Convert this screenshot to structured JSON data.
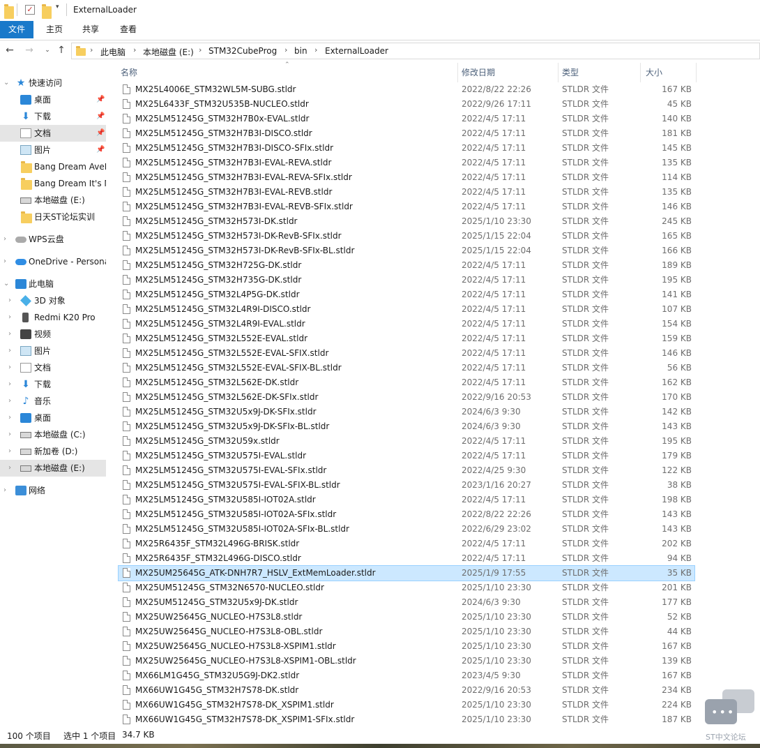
{
  "window": {
    "title": "ExternalLoader"
  },
  "ribbon": {
    "tabs": [
      "文件",
      "主页",
      "共享",
      "查看"
    ]
  },
  "address": {
    "crumbs": [
      "此电脑",
      "本地磁盘 (E:)",
      "STM32CubeProg",
      "bin",
      "ExternalLoader"
    ]
  },
  "sidebar": {
    "items": [
      {
        "label": "快速访问",
        "icon": "star-icon"
      },
      {
        "label": "桌面",
        "icon": "desktop-icon",
        "pinned": true
      },
      {
        "label": "下载",
        "icon": "download-icon",
        "pinned": true
      },
      {
        "label": "文档",
        "icon": "document-icon",
        "pinned": true
      },
      {
        "label": "图片",
        "icon": "picture-icon",
        "pinned": true
      },
      {
        "label": "Bang Dream AveM",
        "icon": "folder-icon"
      },
      {
        "label": "Bang Dream It's M",
        "icon": "folder-icon"
      },
      {
        "label": "本地磁盘 (E:)",
        "icon": "drive-icon"
      },
      {
        "label": "日天ST论坛实训",
        "icon": "folder-icon"
      },
      {
        "label": "WPS云盘",
        "icon": "cloud-icon"
      },
      {
        "label": "OneDrive - Persona",
        "icon": "onedrive-icon"
      },
      {
        "label": "此电脑",
        "icon": "computer-icon"
      },
      {
        "label": "3D 对象",
        "icon": "cube-icon"
      },
      {
        "label": "Redmi K20 Pro",
        "icon": "phone-icon"
      },
      {
        "label": "视频",
        "icon": "video-icon"
      },
      {
        "label": "图片",
        "icon": "picture-icon"
      },
      {
        "label": "文档",
        "icon": "document-icon"
      },
      {
        "label": "下载",
        "icon": "download-icon"
      },
      {
        "label": "音乐",
        "icon": "music-icon"
      },
      {
        "label": "桌面",
        "icon": "desktop-icon"
      },
      {
        "label": "本地磁盘 (C:)",
        "icon": "drive-icon"
      },
      {
        "label": "新加卷 (D:)",
        "icon": "drive-icon"
      },
      {
        "label": "本地磁盘 (E:)",
        "icon": "drive-icon"
      },
      {
        "label": "网络",
        "icon": "network-icon"
      }
    ]
  },
  "columns": {
    "name": "名称",
    "date": "修改日期",
    "type": "类型",
    "size": "大小"
  },
  "files": [
    {
      "name": "MX25L4006E_STM32WL5M-SUBG.stldr",
      "date": "2022/8/22 22:26",
      "type": "STLDR 文件",
      "size": "167 KB"
    },
    {
      "name": "MX25L6433F_STM32U535B-NUCLEO.stldr",
      "date": "2022/9/26 17:11",
      "type": "STLDR 文件",
      "size": "45 KB"
    },
    {
      "name": "MX25LM51245G_STM32H7B0x-EVAL.stldr",
      "date": "2022/4/5 17:11",
      "type": "STLDR 文件",
      "size": "140 KB"
    },
    {
      "name": "MX25LM51245G_STM32H7B3I-DISCO.stldr",
      "date": "2022/4/5 17:11",
      "type": "STLDR 文件",
      "size": "181 KB"
    },
    {
      "name": "MX25LM51245G_STM32H7B3I-DISCO-SFIx.stldr",
      "date": "2022/4/5 17:11",
      "type": "STLDR 文件",
      "size": "145 KB"
    },
    {
      "name": "MX25LM51245G_STM32H7B3I-EVAL-REVA.stldr",
      "date": "2022/4/5 17:11",
      "type": "STLDR 文件",
      "size": "135 KB"
    },
    {
      "name": "MX25LM51245G_STM32H7B3I-EVAL-REVA-SFIx.stldr",
      "date": "2022/4/5 17:11",
      "type": "STLDR 文件",
      "size": "114 KB"
    },
    {
      "name": "MX25LM51245G_STM32H7B3I-EVAL-REVB.stldr",
      "date": "2022/4/5 17:11",
      "type": "STLDR 文件",
      "size": "135 KB"
    },
    {
      "name": "MX25LM51245G_STM32H7B3I-EVAL-REVB-SFIx.stldr",
      "date": "2022/4/5 17:11",
      "type": "STLDR 文件",
      "size": "146 KB"
    },
    {
      "name": "MX25LM51245G_STM32H573I-DK.stldr",
      "date": "2025/1/10 23:30",
      "type": "STLDR 文件",
      "size": "245 KB"
    },
    {
      "name": "MX25LM51245G_STM32H573I-DK-RevB-SFIx.stldr",
      "date": "2025/1/15 22:04",
      "type": "STLDR 文件",
      "size": "165 KB"
    },
    {
      "name": "MX25LM51245G_STM32H573I-DK-RevB-SFIx-BL.stldr",
      "date": "2025/1/15 22:04",
      "type": "STLDR 文件",
      "size": "166 KB"
    },
    {
      "name": "MX25LM51245G_STM32H725G-DK.stldr",
      "date": "2022/4/5 17:11",
      "type": "STLDR 文件",
      "size": "189 KB"
    },
    {
      "name": "MX25LM51245G_STM32H735G-DK.stldr",
      "date": "2022/4/5 17:11",
      "type": "STLDR 文件",
      "size": "195 KB"
    },
    {
      "name": "MX25LM51245G_STM32L4P5G-DK.stldr",
      "date": "2022/4/5 17:11",
      "type": "STLDR 文件",
      "size": "141 KB"
    },
    {
      "name": "MX25LM51245G_STM32L4R9I-DISCO.stldr",
      "date": "2022/4/5 17:11",
      "type": "STLDR 文件",
      "size": "107 KB"
    },
    {
      "name": "MX25LM51245G_STM32L4R9I-EVAL.stldr",
      "date": "2022/4/5 17:11",
      "type": "STLDR 文件",
      "size": "154 KB"
    },
    {
      "name": "MX25LM51245G_STM32L552E-EVAL.stldr",
      "date": "2022/4/5 17:11",
      "type": "STLDR 文件",
      "size": "159 KB"
    },
    {
      "name": "MX25LM51245G_STM32L552E-EVAL-SFIX.stldr",
      "date": "2022/4/5 17:11",
      "type": "STLDR 文件",
      "size": "146 KB"
    },
    {
      "name": "MX25LM51245G_STM32L552E-EVAL-SFIX-BL.stldr",
      "date": "2022/4/5 17:11",
      "type": "STLDR 文件",
      "size": "56 KB"
    },
    {
      "name": "MX25LM51245G_STM32L562E-DK.stldr",
      "date": "2022/4/5 17:11",
      "type": "STLDR 文件",
      "size": "162 KB"
    },
    {
      "name": "MX25LM51245G_STM32L562E-DK-SFIx.stldr",
      "date": "2022/9/16 20:53",
      "type": "STLDR 文件",
      "size": "170 KB"
    },
    {
      "name": "MX25LM51245G_STM32U5x9J-DK-SFIx.stldr",
      "date": "2024/6/3 9:30",
      "type": "STLDR 文件",
      "size": "142 KB"
    },
    {
      "name": "MX25LM51245G_STM32U5x9J-DK-SFIx-BL.stldr",
      "date": "2024/6/3 9:30",
      "type": "STLDR 文件",
      "size": "143 KB"
    },
    {
      "name": "MX25LM51245G_STM32U59x.stldr",
      "date": "2022/4/5 17:11",
      "type": "STLDR 文件",
      "size": "195 KB"
    },
    {
      "name": "MX25LM51245G_STM32U575I-EVAL.stldr",
      "date": "2022/4/5 17:11",
      "type": "STLDR 文件",
      "size": "179 KB"
    },
    {
      "name": "MX25LM51245G_STM32U575I-EVAL-SFIx.stldr",
      "date": "2022/4/25 9:30",
      "type": "STLDR 文件",
      "size": "122 KB"
    },
    {
      "name": "MX25LM51245G_STM32U575I-EVAL-SFIX-BL.stldr",
      "date": "2023/1/16 20:27",
      "type": "STLDR 文件",
      "size": "38 KB"
    },
    {
      "name": "MX25LM51245G_STM32U585I-IOT02A.stldr",
      "date": "2022/4/5 17:11",
      "type": "STLDR 文件",
      "size": "198 KB"
    },
    {
      "name": "MX25LM51245G_STM32U585I-IOT02A-SFIx.stldr",
      "date": "2022/8/22 22:26",
      "type": "STLDR 文件",
      "size": "143 KB"
    },
    {
      "name": "MX25LM51245G_STM32U585I-IOT02A-SFIx-BL.stldr",
      "date": "2022/6/29 23:02",
      "type": "STLDR 文件",
      "size": "143 KB"
    },
    {
      "name": "MX25R6435F_STM32L496G-BRISK.stldr",
      "date": "2022/4/5 17:11",
      "type": "STLDR 文件",
      "size": "202 KB"
    },
    {
      "name": "MX25R6435F_STM32L496G-DISCO.stldr",
      "date": "2022/4/5 17:11",
      "type": "STLDR 文件",
      "size": "94 KB"
    },
    {
      "name": "MX25UM25645G_ATK-DNH7R7_HSLV_ExtMemLoader.stldr",
      "date": "2025/1/9 17:55",
      "type": "STLDR 文件",
      "size": "35 KB",
      "selected": true
    },
    {
      "name": "MX25UM51245G_STM32N6570-NUCLEO.stldr",
      "date": "2025/1/10 23:30",
      "type": "STLDR 文件",
      "size": "201 KB"
    },
    {
      "name": "MX25UM51245G_STM32U5x9J-DK.stldr",
      "date": "2024/6/3 9:30",
      "type": "STLDR 文件",
      "size": "177 KB"
    },
    {
      "name": "MX25UW25645G_NUCLEO-H7S3L8.stldr",
      "date": "2025/1/10 23:30",
      "type": "STLDR 文件",
      "size": "52 KB"
    },
    {
      "name": "MX25UW25645G_NUCLEO-H7S3L8-OBL.stldr",
      "date": "2025/1/10 23:30",
      "type": "STLDR 文件",
      "size": "44 KB"
    },
    {
      "name": "MX25UW25645G_NUCLEO-H7S3L8-XSPIM1.stldr",
      "date": "2025/1/10 23:30",
      "type": "STLDR 文件",
      "size": "167 KB"
    },
    {
      "name": "MX25UW25645G_NUCLEO-H7S3L8-XSPIM1-OBL.stldr",
      "date": "2025/1/10 23:30",
      "type": "STLDR 文件",
      "size": "139 KB"
    },
    {
      "name": "MX66LM1G45G_STM32U5G9J-DK2.stldr",
      "date": "2023/4/5 9:30",
      "type": "STLDR 文件",
      "size": "167 KB"
    },
    {
      "name": "MX66UW1G45G_STM32H7S78-DK.stldr",
      "date": "2022/9/16 20:53",
      "type": "STLDR 文件",
      "size": "234 KB"
    },
    {
      "name": "MX66UW1G45G_STM32H7S78-DK_XSPIM1.stldr",
      "date": "2025/1/10 23:30",
      "type": "STLDR 文件",
      "size": "224 KB"
    },
    {
      "name": "MX66UW1G45G_STM32H7S78-DK_XSPIM1-SFIx.stldr",
      "date": "2025/1/10 23:30",
      "type": "STLDR 文件",
      "size": "187 KB"
    }
  ],
  "status": {
    "count": "100 个项目",
    "selection": "选中 1 个项目",
    "size": "34.7 KB"
  },
  "watermark": {
    "text": "ST中文论坛"
  },
  "colors": {
    "accent": "#1979ca",
    "selection": "#cce8ff",
    "header_text": "#4c607a"
  }
}
